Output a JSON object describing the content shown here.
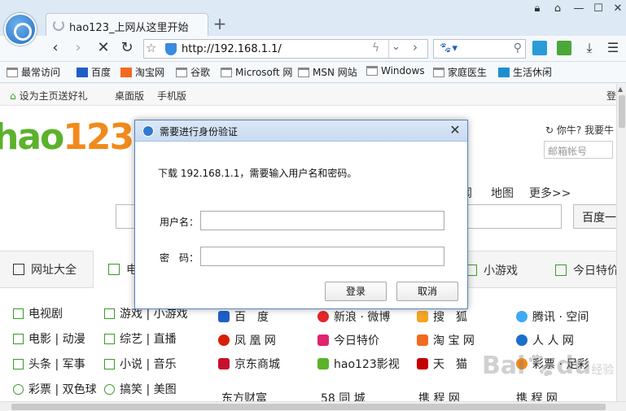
{
  "browser": {
    "tab_title": "hao123_上网从这里开始",
    "new_tab": "+",
    "url": "http://192.168.1.1/",
    "bookmarks": [
      "最常访问",
      "百度",
      "淘宝网",
      "谷歌",
      "Microsoft 网",
      "MSN 网站",
      "Windows",
      "家庭医生",
      "生活休闲"
    ]
  },
  "page": {
    "top_links": [
      "设为主页送好礼",
      "桌面版",
      "手机版"
    ],
    "top_right_partial": "登",
    "logo_main": "hao",
    "logo_num": "123",
    "weather_text": "你牛? 我要牛",
    "mail_placeholder": "邮箱帐号",
    "search_links": [
      "闻",
      "地图",
      "更多>>"
    ],
    "search_button": "百度一",
    "tabs": [
      "网址大全",
      "电",
      "小游戏",
      "今日特价"
    ],
    "left_cats": [
      [
        "电视剧",
        "游戏 | 小游戏"
      ],
      [
        "电影 | 动漫",
        "综艺 | 直播"
      ],
      [
        "头条 | 军事",
        "小说 | 音乐"
      ],
      [
        "彩票 | 双色球",
        "搞笑 | 美图"
      ]
    ],
    "sites": [
      [
        "百　度",
        "新浪 · 微博",
        "搜　狐",
        "腾讯 · 空间"
      ],
      [
        "凤 凰 网",
        "今日特价",
        "淘 宝 网",
        "人 人 网"
      ],
      [
        "京东商城",
        "hao123影视",
        "天　猫",
        "彩票 · 足彩"
      ],
      [
        "东方财富",
        "58 同 城",
        "携 程 网",
        "携 程 网"
      ]
    ]
  },
  "dialog": {
    "title": "需要进行身份验证",
    "close": "✕",
    "message": "下载 192.168.1.1，需要输入用户名和密码。",
    "username_label": "用户名：",
    "password_label": "密　码：",
    "ok": "登录",
    "cancel": "取消"
  },
  "watermark": {
    "main": "Bai",
    "paw": "du",
    "sub": "经验"
  }
}
